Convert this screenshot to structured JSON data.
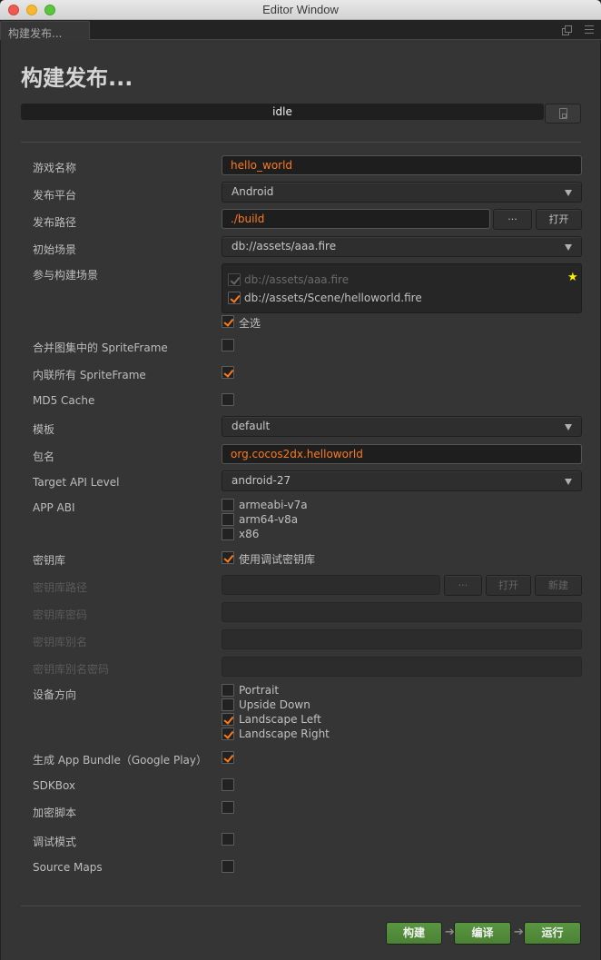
{
  "window": {
    "title": "Editor Window"
  },
  "tab": {
    "label": "构建发布..."
  },
  "header": {
    "title": "构建发布...",
    "status": "idle"
  },
  "colors": {
    "accent": "#fd7a1e",
    "run_green": "#4f8a37",
    "star": "#ffee00"
  },
  "form": {
    "game_name": {
      "label": "游戏名称",
      "value": "hello_world"
    },
    "platform": {
      "label": "发布平台",
      "value": "Android"
    },
    "build_path": {
      "label": "发布路径",
      "value": "./build",
      "browse": "···",
      "open": "打开"
    },
    "start_scene": {
      "label": "初始场景",
      "value": "db://assets/aaa.fire"
    },
    "scenes": {
      "label": "参与构建场景",
      "items": [
        {
          "path": "db://assets/aaa.fire",
          "checked": true,
          "disabled": true
        },
        {
          "path": "db://assets/Scene/helloworld.fire",
          "checked": true,
          "disabled": false
        }
      ],
      "select_all": "全选"
    },
    "merge_spriteframe": {
      "label": "合并图集中的 SpriteFrame",
      "checked": false
    },
    "inline_spriteframe": {
      "label": "内联所有 SpriteFrame",
      "checked": true
    },
    "md5_cache": {
      "label": "MD5 Cache",
      "checked": false
    },
    "template": {
      "label": "模板",
      "value": "default"
    },
    "package_name": {
      "label": "包名",
      "value": "org.cocos2dx.helloworld"
    },
    "target_api": {
      "label": "Target API Level",
      "value": "android-27"
    },
    "app_abi": {
      "label": "APP ABI",
      "options": [
        {
          "name": "armeabi-v7a",
          "checked": false
        },
        {
          "name": "arm64-v8a",
          "checked": false
        },
        {
          "name": "x86",
          "checked": false
        }
      ]
    },
    "keystore": {
      "label": "密钥库",
      "option": "使用调试密钥库",
      "checked": true
    },
    "keystore_path": {
      "label": "密钥库路径",
      "value": "",
      "browse": "···",
      "open": "打开",
      "new": "新建"
    },
    "keystore_password": {
      "label": "密钥库密码",
      "value": ""
    },
    "keystore_alias": {
      "label": "密钥库别名",
      "value": ""
    },
    "keystore_alias_password": {
      "label": "密钥库别名密码",
      "value": ""
    },
    "orientation": {
      "label": "设备方向",
      "options": [
        {
          "name": "Portrait",
          "checked": false
        },
        {
          "name": "Upside Down",
          "checked": false
        },
        {
          "name": "Landscape Left",
          "checked": true
        },
        {
          "name": "Landscape Right",
          "checked": true
        }
      ]
    },
    "app_bundle": {
      "label": "生成 App Bundle（Google Play）",
      "checked": true
    },
    "sdkbox": {
      "label": "SDKBox",
      "checked": false
    },
    "encrypt_js": {
      "label": "加密脚本",
      "checked": false
    },
    "debug": {
      "label": "调试模式",
      "checked": false
    },
    "source_maps": {
      "label": "Source Maps",
      "checked": false
    }
  },
  "actions": {
    "build": "构建",
    "compile": "编译",
    "run": "运行",
    "arrow": "➔"
  }
}
